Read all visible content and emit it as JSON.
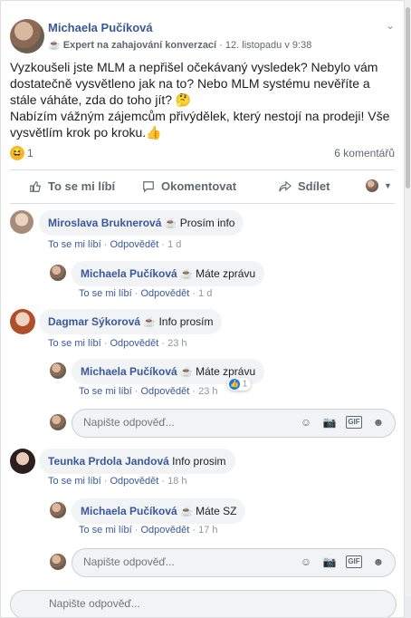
{
  "post": {
    "author": "Michaela Pučíková",
    "badge": "Expert na zahajování konverzací",
    "date": "12. listopadu v 9:38",
    "separator": " · ",
    "text_p1": "Vyzkoušeli jste MLM a nepřišel očekávaný vysledek? Nebylo vám dostatečně vysvětleno jak na to? Nebo MLM systému nevěříte a stále váháte, zda do toho jít? 🤔",
    "text_p2": "Nabízím vážným zájemcům přivýdělek, který nestojí na prodeji! Vše vysvětlím krok po kroku.👍",
    "reaction_count": "1",
    "comments_count": "6 komentářů"
  },
  "actions": {
    "like": "To se mi líbí",
    "comment": "Okomentovat",
    "share": "Sdílet"
  },
  "link_labels": {
    "like": "To se mi líbí",
    "reply": "Odpovědět"
  },
  "comments": [
    {
      "name": "Miroslava Bruknerová",
      "text": "Prosím info",
      "time": "1 d"
    },
    {
      "name": "Michaela Pučíková",
      "text": "Máte zprávu",
      "time": "1 d"
    },
    {
      "name": "Dagmar Sýkorová",
      "text": "Info prosím",
      "time": "23 h"
    },
    {
      "name": "Michaela Pučíková",
      "text": "Máte zprávu",
      "time": "23 h",
      "likes": "1"
    },
    {
      "name": "Teunka Prdola Jandová",
      "text": "Info prosim",
      "time": "18 h"
    },
    {
      "name": "Michaela Pučíková",
      "text": "Máte SZ",
      "time": "17 h"
    }
  ],
  "reply_placeholder": "Napište odpověď...",
  "partial_placeholder": "Napište odpověď...",
  "colors": {
    "link": "#385898",
    "bubble": "#f2f3f5",
    "meta": "#616770"
  }
}
